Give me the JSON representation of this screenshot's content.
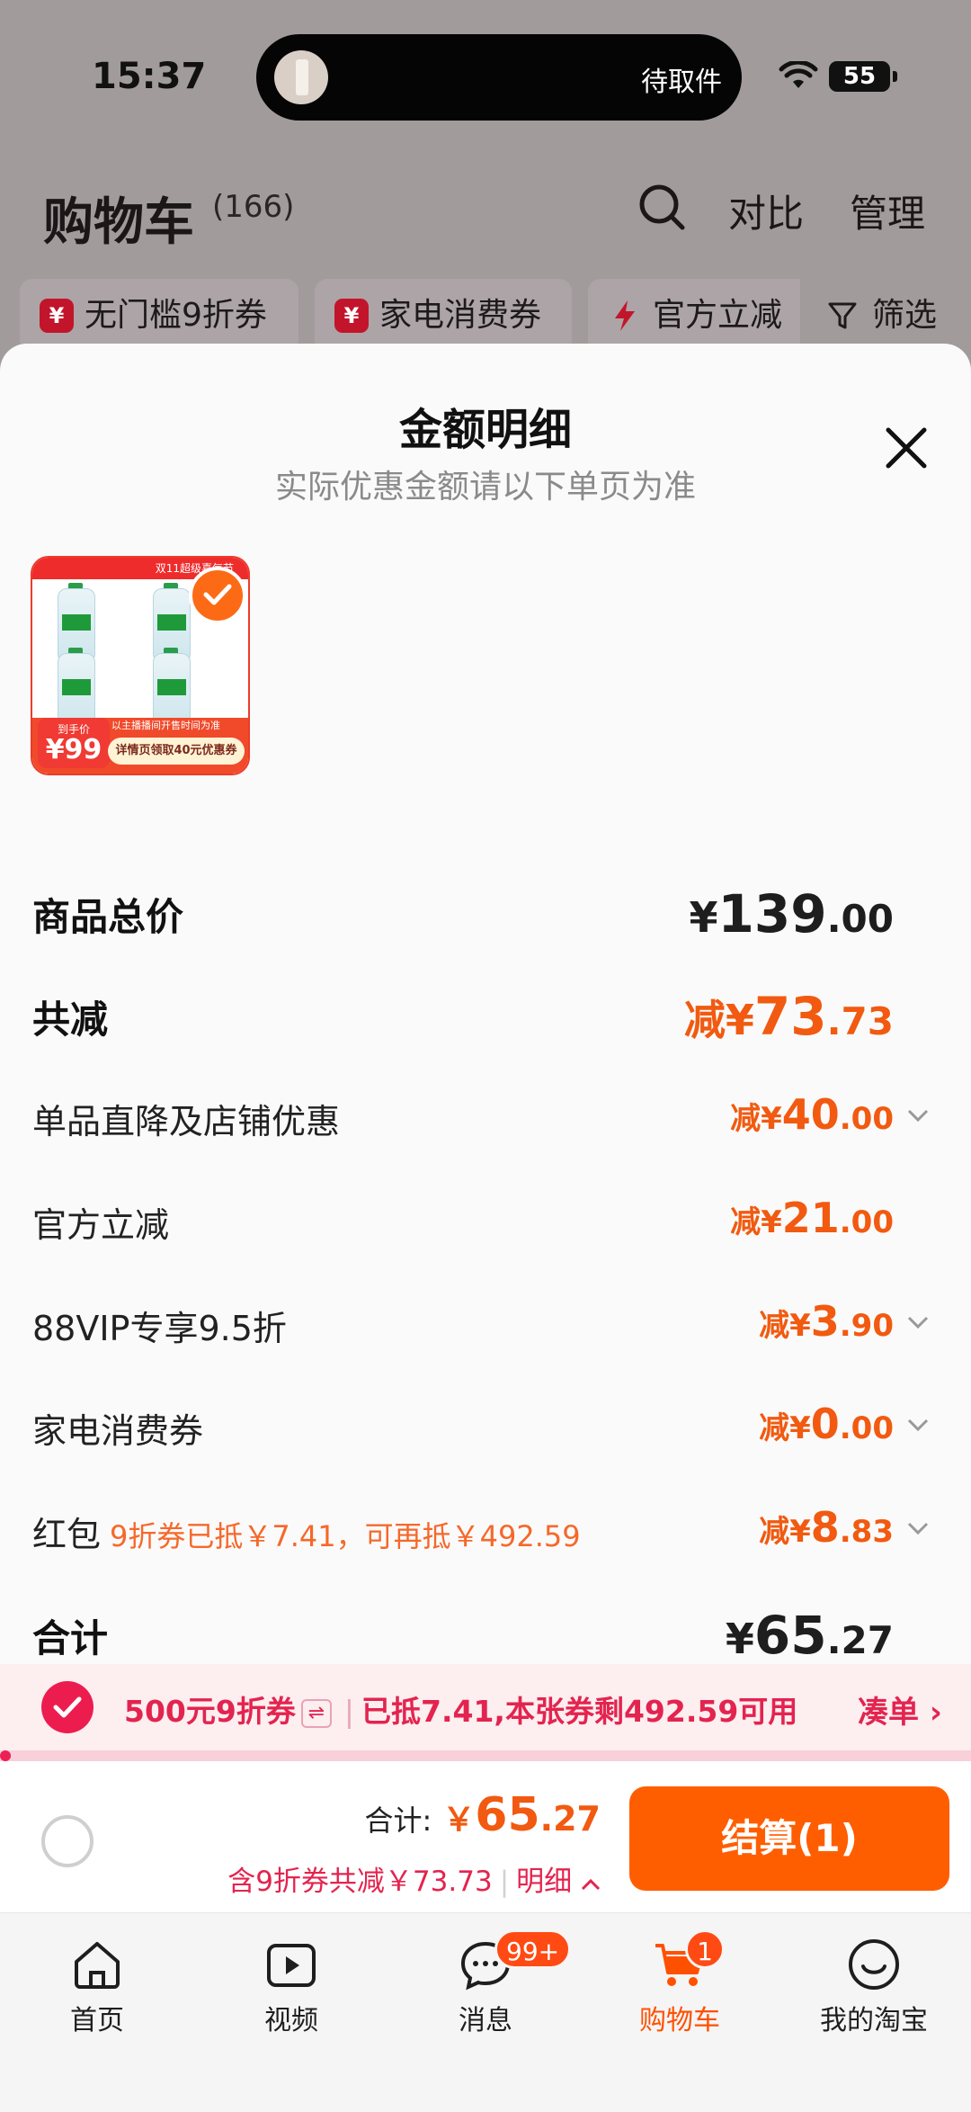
{
  "status_bar": {
    "time": "15:37",
    "island_text": "待取件",
    "battery": "55"
  },
  "header": {
    "title": "购物车",
    "count": "(166)",
    "compare": "对比",
    "manage": "管理"
  },
  "filter_chips": [
    {
      "label": "无门槛9折券",
      "icon": "yen-coupon-icon"
    },
    {
      "label": "家电消费券",
      "icon": "yen-coupon-icon"
    },
    {
      "label": "官方立减",
      "icon": "lightning-icon"
    }
  ],
  "filter_label": "筛选",
  "sheet": {
    "title": "金额明细",
    "subtitle": "实际优惠金额请以下单页为准",
    "product": {
      "top_banner": "双11超级喜气节",
      "price_badge_label": "到手价",
      "price_badge_value": "¥99",
      "strip_text": "以主播播间开售时间为准",
      "tag": "详情页领取40元优惠券"
    },
    "rows": [
      {
        "label": "商品总价",
        "prefix": "¥",
        "int": "139",
        "dec": ".00"
      },
      {
        "label": "共减",
        "prefix": "减¥",
        "int": "73",
        "dec": ".73"
      },
      {
        "label": "单品直降及店铺优惠",
        "prefix": "减¥",
        "int": "40",
        "dec": ".00"
      },
      {
        "label": "官方立减",
        "prefix": "减¥",
        "int": "21",
        "dec": ".00"
      },
      {
        "label": "88VIP专享9.5折",
        "prefix": "减¥",
        "int": "3",
        "dec": ".90"
      },
      {
        "label": "家电消费券",
        "prefix": "减¥",
        "int": "0",
        "dec": ".00"
      },
      {
        "label": "红包",
        "note": "9折券已抵￥7.41，可再抵￥492.59",
        "prefix": "减¥",
        "int": "8",
        "dec": ".83"
      },
      {
        "label": "合计",
        "prefix": "¥",
        "int": "65",
        "dec": ".27"
      }
    ]
  },
  "coupon_bar": {
    "title": "500元9折券",
    "swap": "⇌",
    "detail": "已抵7.41,本张券剩492.59可用",
    "link": "凑单",
    "progress": 0.01
  },
  "checkout": {
    "total_label": "合计:",
    "currency": "￥",
    "total_int": "65",
    "total_dec": ".27",
    "savings": "含9折券共减￥73.73",
    "detail_link": "明细",
    "pay_button": "结算(1)"
  },
  "tabbar": [
    {
      "label": "首页",
      "icon": "home-icon"
    },
    {
      "label": "视频",
      "icon": "video-icon"
    },
    {
      "label": "消息",
      "icon": "message-icon",
      "badge": "99+"
    },
    {
      "label": "购物车",
      "icon": "cart-icon",
      "badge": "1",
      "active": true
    },
    {
      "label": "我的淘宝",
      "icon": "profile-icon"
    }
  ],
  "colors": {
    "accent_orange": "#ff5e00",
    "discount_text": "#f15a10",
    "coupon_red": "#e3244f"
  }
}
